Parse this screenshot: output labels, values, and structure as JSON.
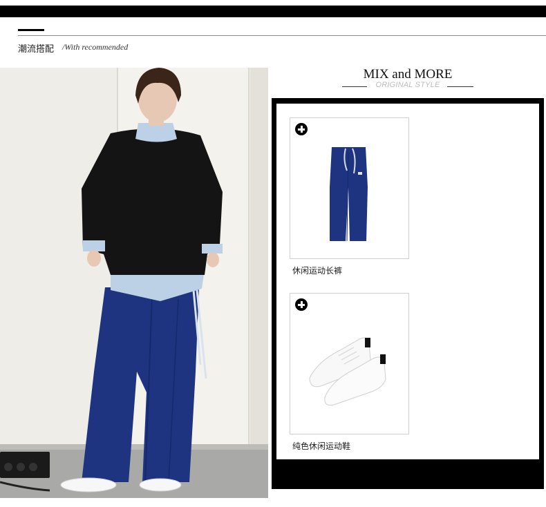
{
  "section": {
    "title": "潮流搭配",
    "subtitle": "/With recommended"
  },
  "panel": {
    "title": "MIX and MORE",
    "subtitle": "ORIGINAL STYLE"
  },
  "products": [
    {
      "name": "休闲运动长裤",
      "icon": "plus-circle-icon"
    },
    {
      "name": "纯色休闲运动鞋",
      "icon": "plus-circle-icon"
    }
  ],
  "colors": {
    "pants_navy": "#1e3480",
    "sweater_black": "#141414",
    "shirt_blue": "#bcd0e6",
    "frame": "#000000"
  }
}
